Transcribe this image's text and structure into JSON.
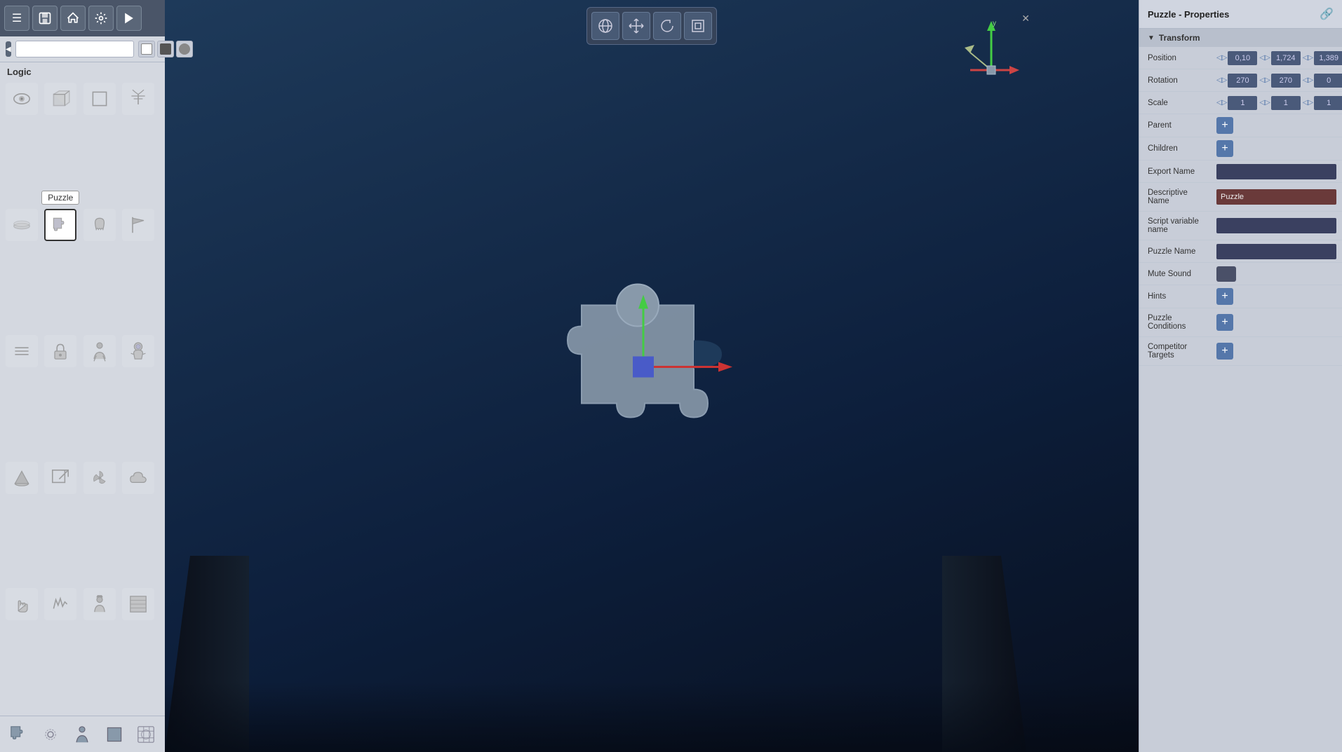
{
  "app": {
    "title": "Puzzle - Properties"
  },
  "toolbar": {
    "menu_label": "☰",
    "save_label": "💾",
    "home_label": "🏠",
    "settings_label": "⚙",
    "play_label": "▶"
  },
  "sidebar": {
    "section_label": "Logic",
    "search_placeholder": "",
    "icons": [
      {
        "name": "eye-icon",
        "label": "Eye",
        "symbol": "👁"
      },
      {
        "name": "cube-icon",
        "label": "Cube",
        "symbol": "⬛"
      },
      {
        "name": "box-icon",
        "label": "Box",
        "symbol": "◻"
      },
      {
        "name": "antenna-icon",
        "label": "Antenna",
        "symbol": "📡"
      },
      {
        "name": "circle-icon",
        "label": "Circle",
        "symbol": "⊙"
      },
      {
        "name": "puzzle-icon",
        "label": "Puzzle",
        "symbol": "🧩",
        "selected": true
      },
      {
        "name": "ghost-icon",
        "label": "Ghost",
        "symbol": "👻"
      },
      {
        "name": "flag-icon",
        "label": "Flag",
        "symbol": "🚩"
      },
      {
        "name": "lines-icon",
        "label": "Lines",
        "symbol": "≡"
      },
      {
        "name": "lock-icon",
        "label": "Lock",
        "symbol": "🔒"
      },
      {
        "name": "person-icon",
        "label": "Person",
        "symbol": "🧍"
      },
      {
        "name": "cone-icon",
        "label": "Cone",
        "symbol": "▽"
      },
      {
        "name": "portal-icon",
        "label": "Portal",
        "symbol": "↗"
      },
      {
        "name": "fan-icon",
        "label": "Fan",
        "symbol": "✳"
      },
      {
        "name": "cloud-icon",
        "label": "Cloud",
        "symbol": "☁"
      },
      {
        "name": "hand-icon",
        "label": "Hand",
        "symbol": "✋"
      },
      {
        "name": "wave-icon",
        "label": "Wave",
        "symbol": "〜"
      },
      {
        "name": "astro-icon",
        "label": "Astronaut",
        "symbol": "👨‍🚀"
      },
      {
        "name": "hat-icon",
        "label": "Hat Person",
        "symbol": "🧑"
      },
      {
        "name": "stripe-icon",
        "label": "Stripes",
        "symbol": "▦"
      }
    ]
  },
  "viewport": {
    "tooltip_active": "Puzzle"
  },
  "viewport_toolbar": {
    "globe_label": "🌐",
    "move_label": "✛",
    "rotate_label": "↻",
    "scale_label": "⊡"
  },
  "properties": {
    "panel_title": "Puzzle - Properties",
    "transform_label": "Transform",
    "fields": {
      "position": {
        "label": "Position",
        "x": "0,10",
        "y": "1,724",
        "z": "1,389"
      },
      "rotation": {
        "label": "Rotation",
        "x": "270",
        "y": "270",
        "z": "0"
      },
      "scale": {
        "label": "Scale",
        "x": "1",
        "y": "1",
        "z": "1"
      },
      "parent": {
        "label": "Parent"
      },
      "children": {
        "label": "Children"
      },
      "export_name": {
        "label": "Export Name",
        "value": ""
      },
      "descriptive_name": {
        "label": "Descriptive Name",
        "value": "Puzzle"
      },
      "script_variable_name": {
        "label": "Script variable name",
        "value": ""
      },
      "puzzle_name": {
        "label": "Puzzle Name",
        "value": ""
      },
      "mute_sound": {
        "label": "Mute Sound"
      },
      "hints": {
        "label": "Hints"
      },
      "puzzle_conditions": {
        "label": "Puzzle Conditions"
      },
      "competitor_targets": {
        "label": "Competitor Targets"
      }
    }
  }
}
